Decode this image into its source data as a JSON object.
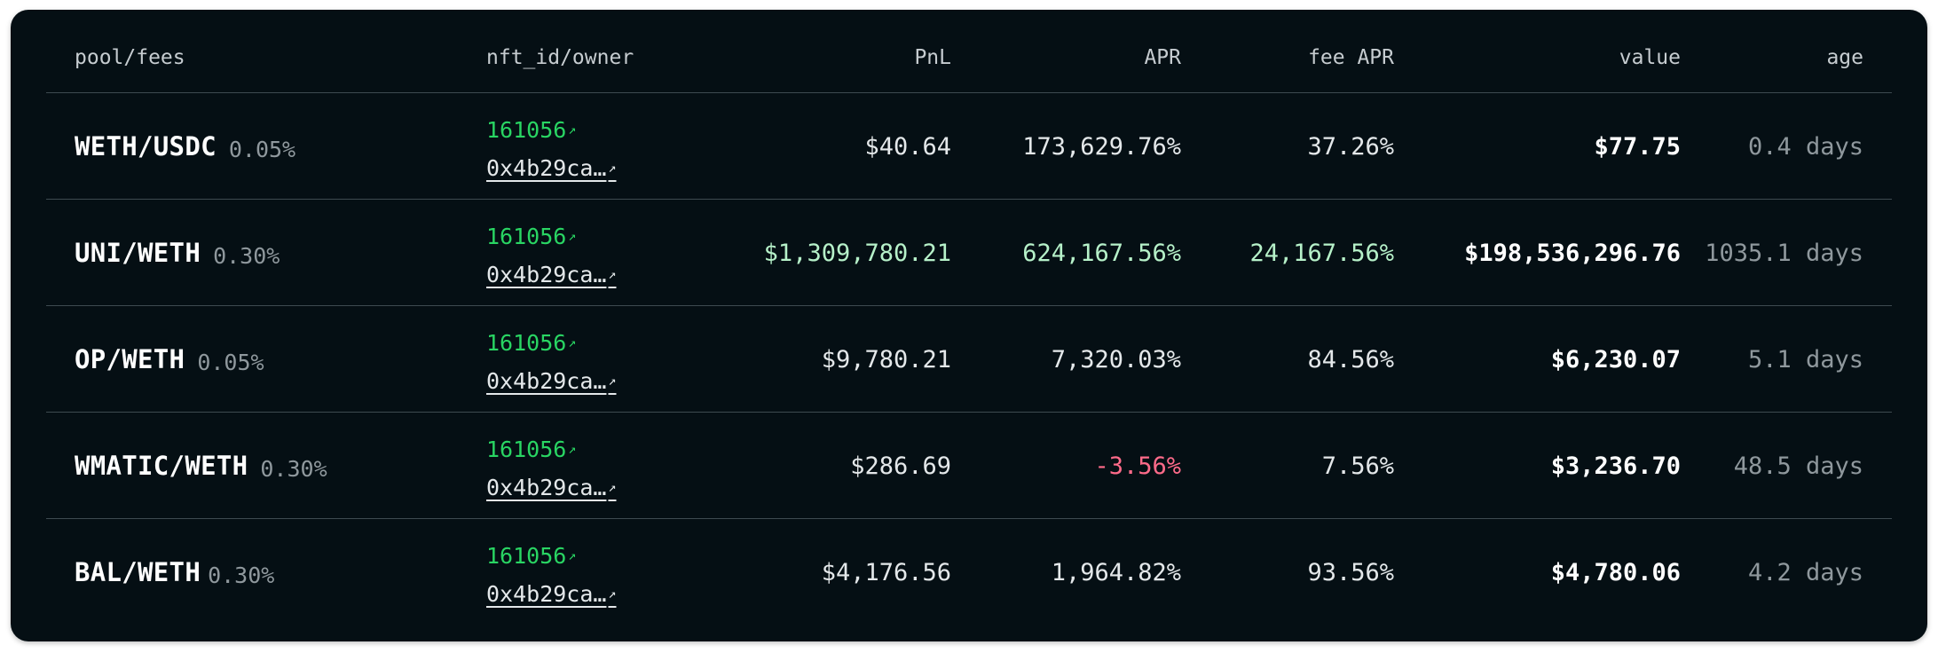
{
  "colors": {
    "panel_background": "#050f14",
    "id_link": "#29d563",
    "positive": "#b6f1c9",
    "negative": "#ff6b8a",
    "muted": "#8f989d"
  },
  "table": {
    "headers": {
      "pool": "pool/fees",
      "nft": "nft_id/owner",
      "pnl": "PnL",
      "apr": "APR",
      "fee_apr": "fee APR",
      "value": "value",
      "age": "age"
    },
    "rows": [
      {
        "pool": "WETH/USDC",
        "fee": "0.05%",
        "nft_id": "161056",
        "owner": "0x4b29ca…",
        "pnl": "$40.64",
        "apr": "173,629.76%",
        "fee_apr": "37.26%",
        "value": "$77.75",
        "age": "0.4 days",
        "tone": "neutral"
      },
      {
        "pool": "UNI/WETH",
        "fee": "0.30%",
        "nft_id": "161056",
        "owner": "0x4b29ca…",
        "pnl": "$1,309,780.21",
        "apr": "624,167.56%",
        "fee_apr": "24,167.56%",
        "value": "$198,536,296.76",
        "age": "1035.1 days",
        "tone": "positive"
      },
      {
        "pool": "OP/WETH",
        "fee": "0.05%",
        "nft_id": "161056",
        "owner": "0x4b29ca…",
        "pnl": "$9,780.21",
        "apr": "7,320.03%",
        "fee_apr": "84.56%",
        "value": "$6,230.07",
        "age": "5.1 days",
        "tone": "neutral"
      },
      {
        "pool": "WMATIC/WETH",
        "fee": "0.30%",
        "nft_id": "161056",
        "owner": "0x4b29ca…",
        "pnl": "$286.69",
        "apr": "-3.56%",
        "fee_apr": "7.56%",
        "value": "$3,236.70",
        "age": "48.5 days",
        "tone": "negative-apr"
      },
      {
        "pool": "BAL/WETH",
        "fee": "0.30%",
        "nft_id": "161056",
        "owner": "0x4b29ca…",
        "pnl": "$4,176.56",
        "apr": "1,964.82%",
        "fee_apr": "93.56%",
        "value": "$4,780.06",
        "age": "4.2 days",
        "tone": "neutral"
      }
    ],
    "link_icon": "external-link-arrow-icon"
  }
}
